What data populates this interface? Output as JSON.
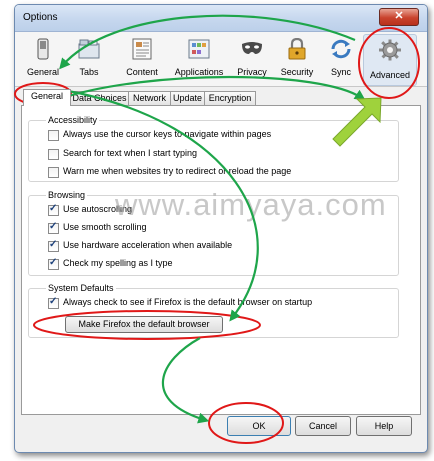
{
  "window": {
    "title": "Options",
    "close_glyph": "✕"
  },
  "toolbar": {
    "items": [
      {
        "label": "General",
        "icon": "switch-icon"
      },
      {
        "label": "Tabs",
        "icon": "tabs-icon"
      },
      {
        "label": "Content",
        "icon": "content-icon"
      },
      {
        "label": "Applications",
        "icon": "applications-icon"
      },
      {
        "label": "Privacy",
        "icon": "mask-icon"
      },
      {
        "label": "Security",
        "icon": "padlock-icon"
      },
      {
        "label": "Sync",
        "icon": "sync-icon"
      },
      {
        "label": "Advanced",
        "icon": "gear-icon"
      }
    ],
    "selected": "Advanced"
  },
  "tabs": {
    "items": [
      "General",
      "Data Choices",
      "Network",
      "Update",
      "Encryption"
    ],
    "active": "General"
  },
  "accessibility": {
    "title": "Accessibility",
    "options": [
      {
        "label": "Always use the cursor keys to navigate within pages",
        "checked": false
      },
      {
        "label": "Search for text when I start typing",
        "checked": false
      },
      {
        "label": "Warn me when websites try to redirect or reload the page",
        "checked": false
      }
    ]
  },
  "browsing": {
    "title": "Browsing",
    "options": [
      {
        "label": "Use autoscrolling",
        "checked": true
      },
      {
        "label": "Use smooth scrolling",
        "checked": true
      },
      {
        "label": "Use hardware acceleration when available",
        "checked": true
      },
      {
        "label": "Check my spelling as I type",
        "checked": true
      }
    ]
  },
  "system_defaults": {
    "title": "System Defaults",
    "option": {
      "label": "Always check to see if Firefox is the default browser on startup",
      "checked": true
    },
    "make_default_label": "Make Firefox the default browser"
  },
  "buttons": {
    "ok": "OK",
    "cancel": "Cancel",
    "help": "Help"
  },
  "watermark": "www.aimyaya.com",
  "colors": {
    "annotation_red": "#e01818",
    "annotation_green": "#1ea54a",
    "arrow_green": "#9fd23c"
  }
}
